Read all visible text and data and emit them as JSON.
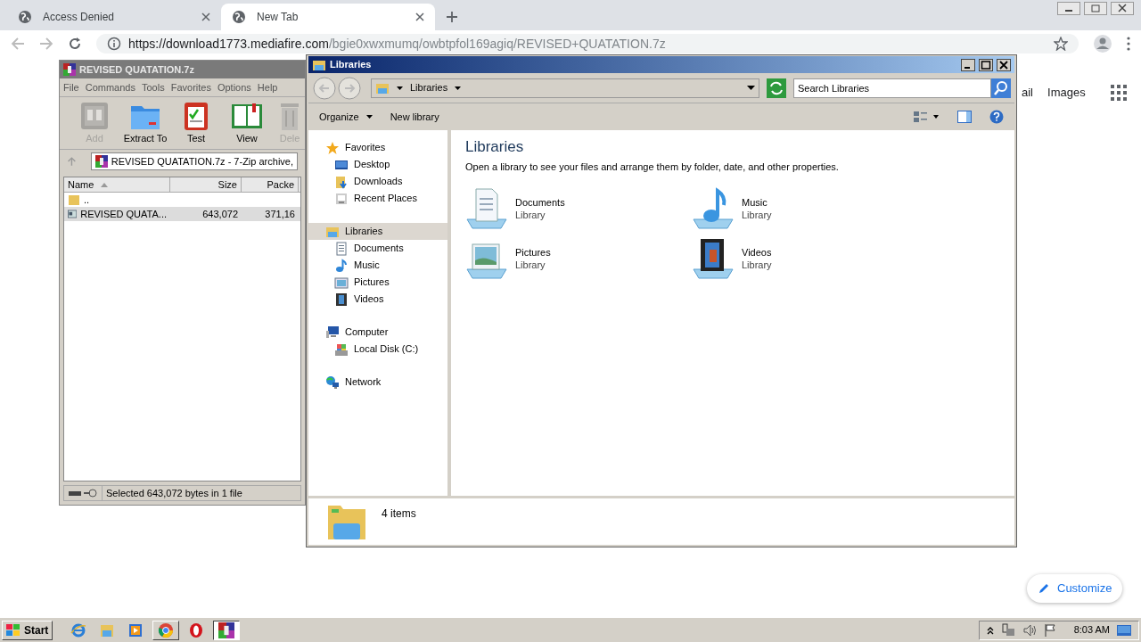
{
  "browser": {
    "tabs": [
      {
        "title": "Access Denied",
        "selected": false
      },
      {
        "title": "New Tab",
        "selected": true
      }
    ],
    "url": {
      "host": "https://download1773.mediafire.com",
      "path": "/bgie0xwxmumq/owbtpfol169agiq/REVISED+QUATATION.7z"
    },
    "page_links": [
      "ail",
      "Images"
    ],
    "customize_button": "Customize"
  },
  "archiver": {
    "title": "REVISED QUATATION.7z",
    "menu": [
      "File",
      "Commands",
      "Tools",
      "Favorites",
      "Options",
      "Help"
    ],
    "toolbar": [
      {
        "kind": "add",
        "label": "Add",
        "disabled": true
      },
      {
        "kind": "extract",
        "label": "Extract To",
        "disabled": false
      },
      {
        "kind": "test",
        "label": "Test",
        "disabled": false
      },
      {
        "kind": "view",
        "label": "View",
        "disabled": false
      },
      {
        "kind": "delete",
        "label": "Dele",
        "disabled": true
      }
    ],
    "path": "REVISED QUATATION.7z - 7-Zip archive,",
    "columns": [
      "Name",
      "Size",
      "Packe"
    ],
    "rows": [
      {
        "kind": "folder",
        "name": "..",
        "selected": false
      },
      {
        "kind": "file",
        "name": "REVISED QUATA...",
        "size": "643,072",
        "packed": "371,16",
        "selected": true
      }
    ],
    "status": "Selected 643,072 bytes in 1 file"
  },
  "explorer": {
    "title": "Libraries",
    "breadcrumb": "Libraries",
    "search_placeholder": "Search Libraries",
    "commands": [
      "Organize",
      "New library"
    ],
    "nav": [
      {
        "kind": "star",
        "label": "Favorites",
        "selected": false,
        "children": [
          {
            "kind": "desktop",
            "label": "Desktop",
            "selected": false
          },
          {
            "kind": "downloads",
            "label": "Downloads",
            "selected": false
          },
          {
            "kind": "recent",
            "label": "Recent Places",
            "selected": false
          }
        ]
      },
      {
        "kind": "libraries",
        "label": "Libraries",
        "selected": true,
        "children": [
          {
            "kind": "documents",
            "label": "Documents",
            "selected": false
          },
          {
            "kind": "music",
            "label": "Music",
            "selected": false
          },
          {
            "kind": "pictures",
            "label": "Pictures",
            "selected": false
          },
          {
            "kind": "videos",
            "label": "Videos",
            "selected": false
          }
        ]
      },
      {
        "kind": "computer",
        "label": "Computer",
        "selected": false,
        "children": [
          {
            "kind": "disk",
            "label": "Local Disk (C:)",
            "selected": false
          }
        ]
      },
      {
        "kind": "network",
        "label": "Network",
        "selected": false
      }
    ],
    "heading": "Libraries",
    "description": "Open a library to see your files and arrange them by folder, date, and other properties.",
    "libraries": [
      {
        "kind": "documents",
        "name": "Documents",
        "subtitle": "Library"
      },
      {
        "kind": "music",
        "name": "Music",
        "subtitle": "Library"
      },
      {
        "kind": "pictures",
        "name": "Pictures",
        "subtitle": "Library"
      },
      {
        "kind": "videos",
        "name": "Videos",
        "subtitle": "Library"
      }
    ],
    "status": "4 items"
  },
  "taskbar": {
    "start": "Start",
    "apps": [
      {
        "kind": "ie",
        "open": false,
        "focused": false
      },
      {
        "kind": "folder",
        "open": false,
        "focused": false
      },
      {
        "kind": "media",
        "open": false,
        "focused": false
      },
      {
        "kind": "chrome",
        "open": true,
        "focused": false
      },
      {
        "kind": "opera",
        "open": false,
        "focused": false
      },
      {
        "kind": "archive",
        "open": true,
        "focused": true
      }
    ],
    "clock": "8:03 AM"
  }
}
